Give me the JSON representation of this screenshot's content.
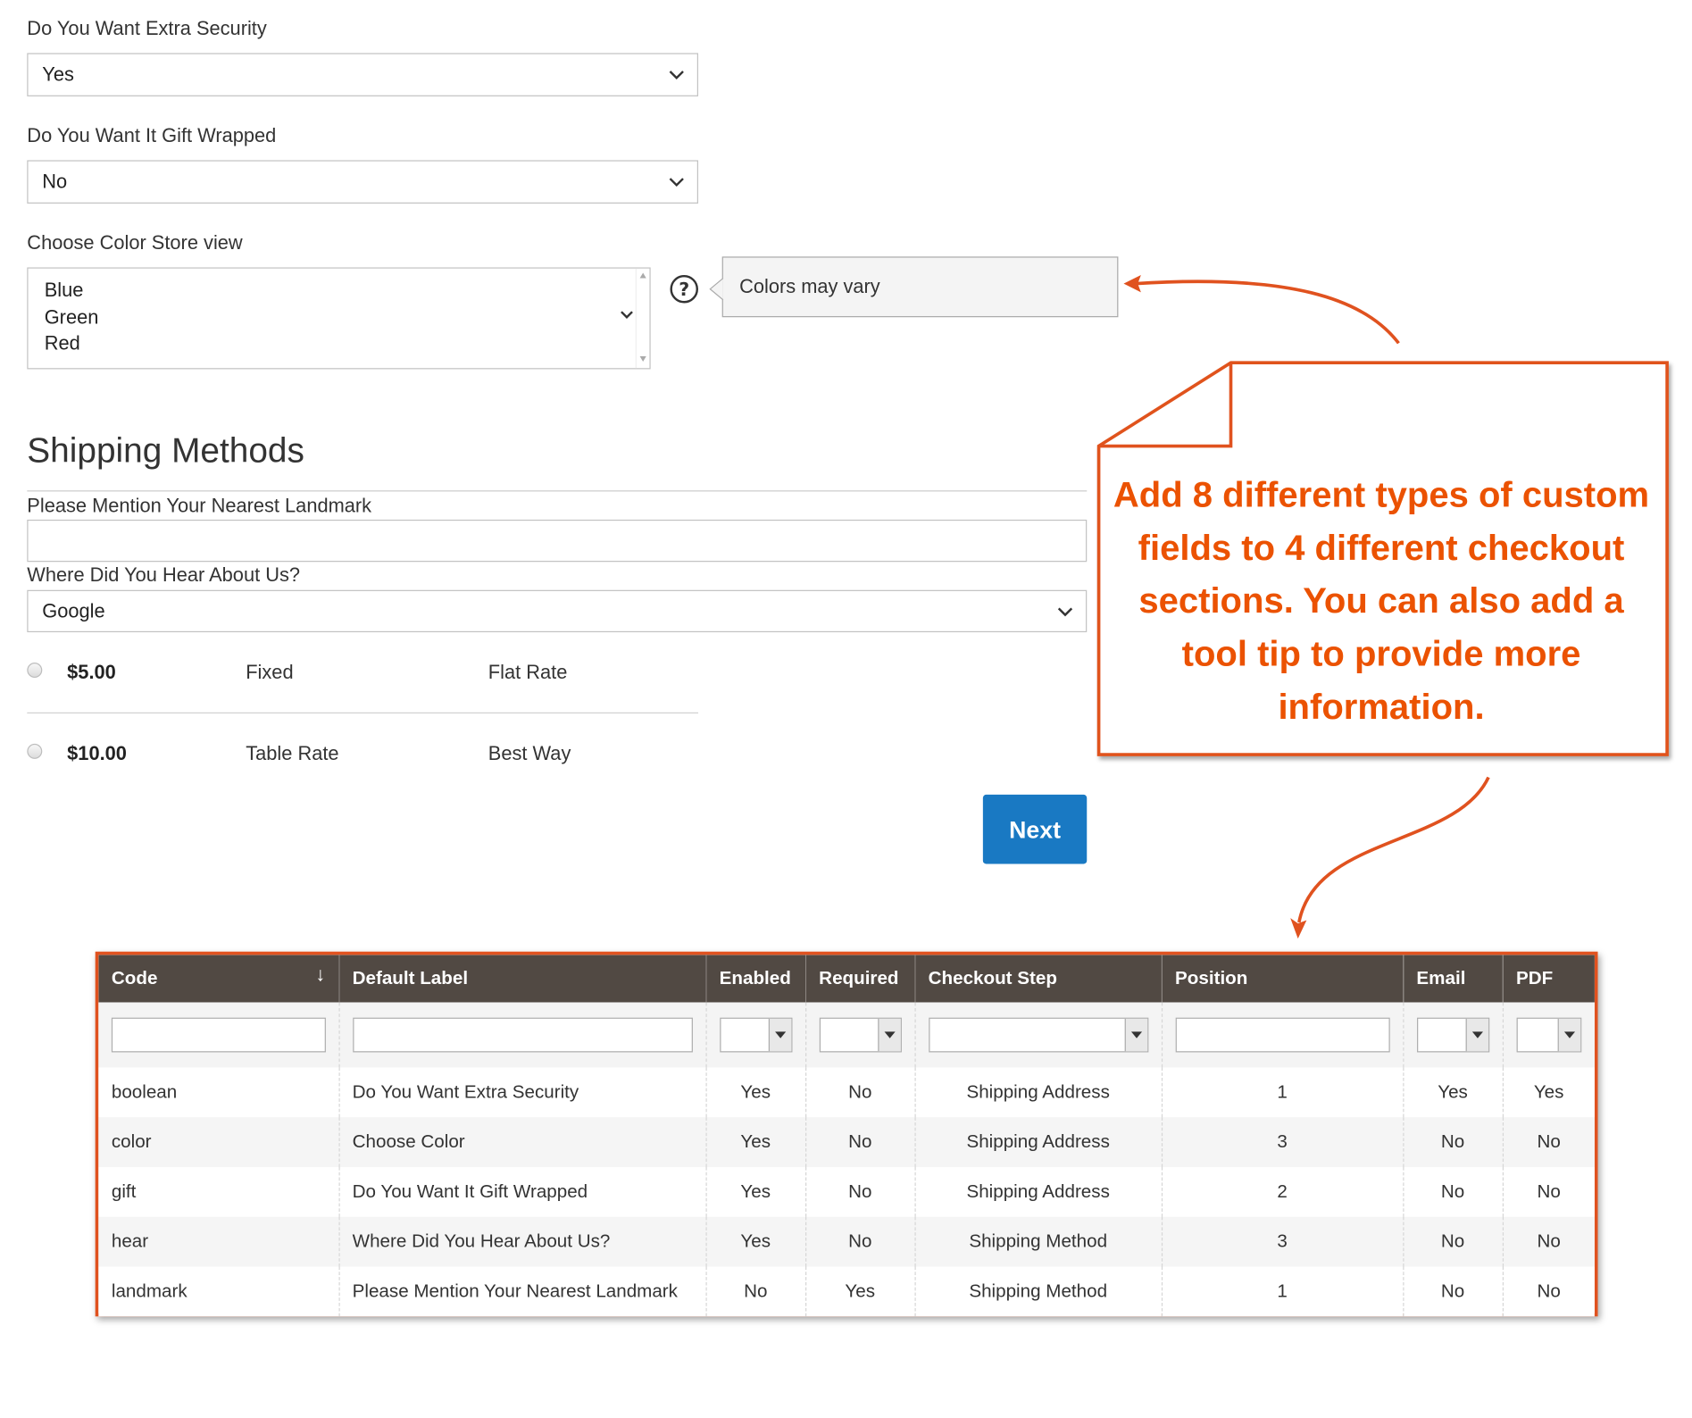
{
  "form": {
    "security": {
      "label": "Do You Want Extra Security",
      "value": "Yes"
    },
    "gift": {
      "label": "Do You Want It Gift Wrapped",
      "value": "No"
    },
    "color": {
      "label": "Choose Color Store view",
      "options": [
        "Blue",
        "Green",
        "Red"
      ]
    },
    "tooltip": {
      "text": "Colors may vary",
      "icon": "question-circle-icon"
    }
  },
  "shipping": {
    "title": "Shipping Methods",
    "landmark_label": "Please Mention Your Nearest Landmark",
    "landmark_value": "",
    "hear_label": "Where Did You Hear About Us?",
    "hear_value": "Google",
    "methods": [
      {
        "price": "$5.00",
        "method": "Fixed",
        "carrier": "Flat Rate"
      },
      {
        "price": "$10.00",
        "method": "Table Rate",
        "carrier": "Best Way"
      }
    ],
    "next_label": "Next"
  },
  "callout": {
    "text": "Add 8 different types of custom fields to 4 different checkout sections. You can also add a tool tip to provide more information.",
    "color": "#eb5202"
  },
  "grid": {
    "columns": [
      "Code",
      "Default Label",
      "Enabled",
      "Required",
      "Checkout Step",
      "Position",
      "Email",
      "PDF"
    ],
    "sort_icon": "sort-down-arrow-icon",
    "rows": [
      {
        "code": "boolean",
        "label": "Do You Want Extra Security",
        "enabled": "Yes",
        "required": "No",
        "step": "Shipping Address",
        "position": "1",
        "email": "Yes",
        "pdf": "Yes"
      },
      {
        "code": "color",
        "label": "Choose Color",
        "enabled": "Yes",
        "required": "No",
        "step": "Shipping Address",
        "position": "3",
        "email": "No",
        "pdf": "No"
      },
      {
        "code": "gift",
        "label": "Do You Want It Gift Wrapped",
        "enabled": "Yes",
        "required": "No",
        "step": "Shipping Address",
        "position": "2",
        "email": "No",
        "pdf": "No"
      },
      {
        "code": "hear",
        "label": "Where Did You Hear About Us?",
        "enabled": "Yes",
        "required": "No",
        "step": "Shipping Method",
        "position": "3",
        "email": "No",
        "pdf": "No"
      },
      {
        "code": "landmark",
        "label": "Please Mention Your Nearest Landmark",
        "enabled": "No",
        "required": "Yes",
        "step": "Shipping Method",
        "position": "1",
        "email": "No",
        "pdf": "No"
      }
    ],
    "header_bg": "#514943",
    "border_color": "#e0521f"
  }
}
